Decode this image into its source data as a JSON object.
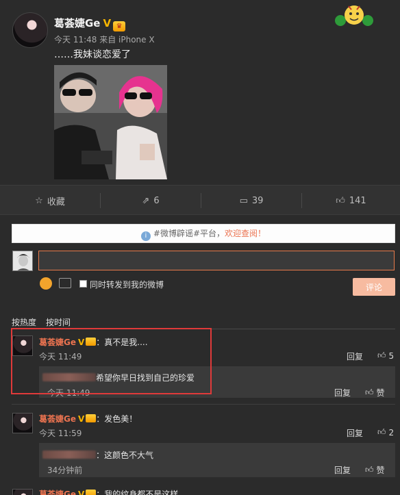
{
  "post": {
    "author": "葛荟婕Ge",
    "verified_badge": "V",
    "meta": "今天 11:48 来自 iPhone X",
    "text": "……我妹谈恋爱了"
  },
  "actions": {
    "favorite_label": "收藏",
    "share_count": "6",
    "comment_count": "39",
    "like_count": "141"
  },
  "notice": {
    "prefix": "#微博辟谣#平台，",
    "highlight": "欢迎查阅！"
  },
  "composer": {
    "input_value": "",
    "repost_label": "同时转发到我的微博",
    "submit_label": "评论"
  },
  "sort": {
    "hot": "按热度",
    "time": "按时间"
  },
  "comments": [
    {
      "author": "葛荟婕Ge",
      "text": "：真不是我....",
      "time": "今天 11:49",
      "reply_label": "回复",
      "likes": "5",
      "sub": {
        "text": "希望你早日找到自己的珍爱",
        "time": "今天 11:49",
        "reply_label": "回复",
        "like_label": "赞"
      }
    },
    {
      "author": "葛荟婕Ge",
      "text": "：发色美！",
      "time": "今天 11:59",
      "reply_label": "回复",
      "likes": "2",
      "sub": {
        "text": "：这颜色不大气",
        "time": "34分钟前",
        "reply_label": "回复",
        "like_label": "赞"
      }
    },
    {
      "author": "葛荟婕Ge",
      "text": "：我的纹身都不是这样"
    }
  ],
  "colors": {
    "accent": "#eb7350",
    "highlight_box": "#e03a3a",
    "background": "#2b2b2b"
  }
}
